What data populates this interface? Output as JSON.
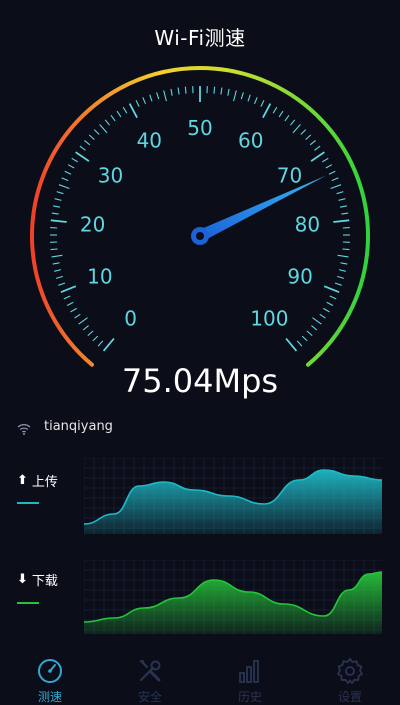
{
  "header": {
    "title": "Wi-Fi测速"
  },
  "gauge": {
    "labels": [
      "0",
      "10",
      "20",
      "30",
      "40",
      "50",
      "60",
      "70",
      "80",
      "90",
      "100"
    ],
    "min": 0,
    "max": 100,
    "needle_value": 73
  },
  "speed": {
    "text": "75.04Mps"
  },
  "network": {
    "ssid": "tianqiyang",
    "icon": "wifi-icon"
  },
  "upload": {
    "label": "上传",
    "color": "#1fb9c6"
  },
  "download": {
    "label": "下载",
    "color": "#26c43a"
  },
  "tabs": [
    {
      "label": "测速",
      "icon": "speedometer-icon",
      "active": true
    },
    {
      "label": "安全",
      "icon": "tools-icon",
      "active": false
    },
    {
      "label": "历史",
      "icon": "bar-chart-icon",
      "active": false
    },
    {
      "label": "设置",
      "icon": "gear-icon",
      "active": false
    }
  ]
}
